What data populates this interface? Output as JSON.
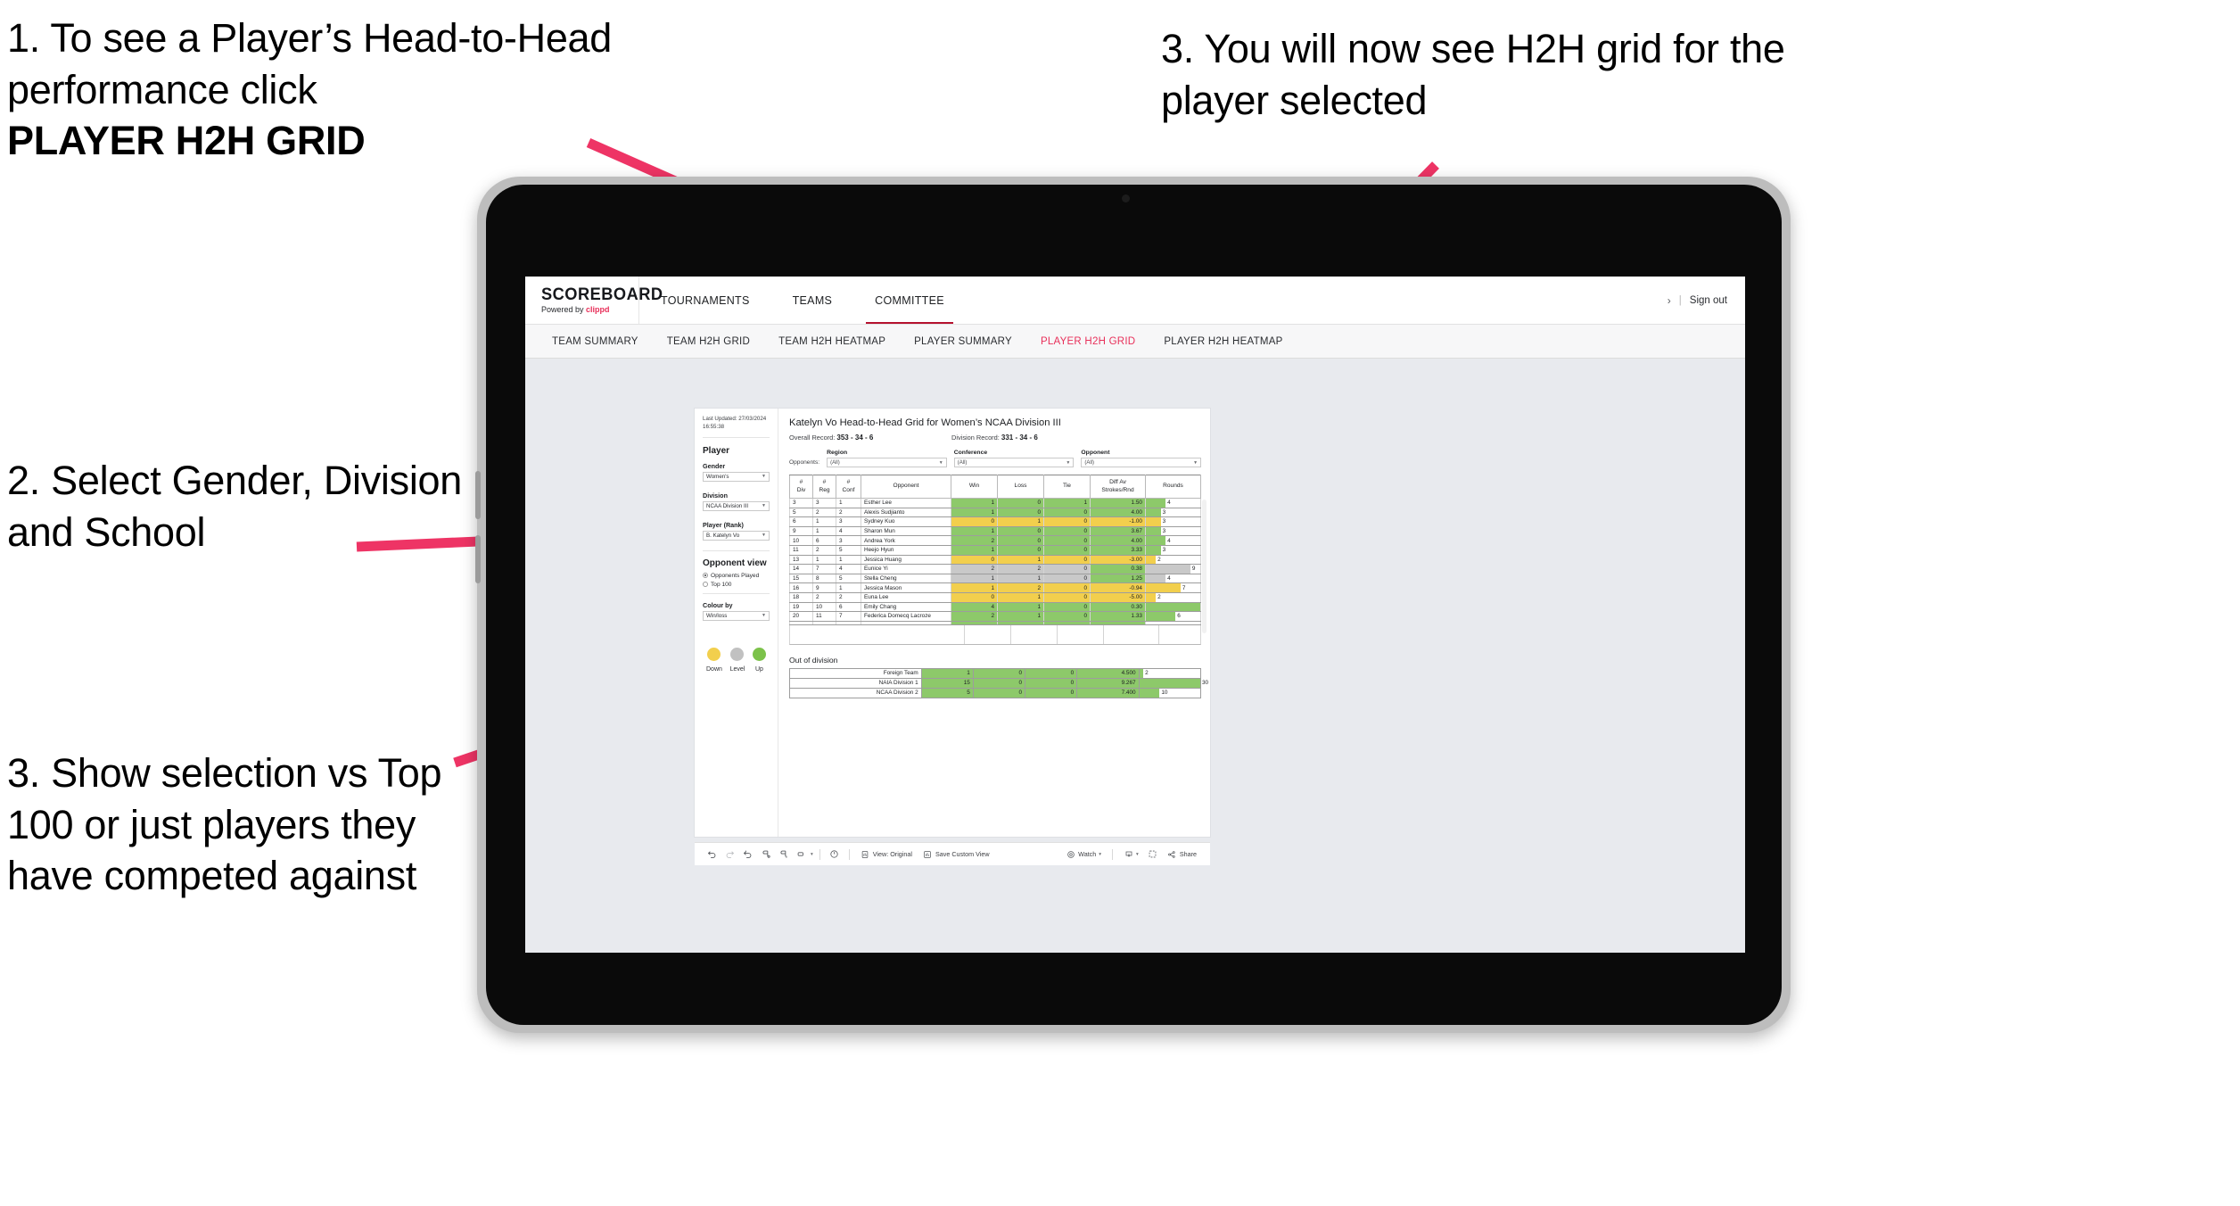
{
  "annotations": {
    "step1_line1": "1. To see a Player’s Head-to-Head performance click",
    "step1_bold": "PLAYER H2H GRID",
    "step2": "2. Select Gender, Division and School",
    "step3_left": "3. Show selection vs Top 100 or just players they have competed against",
    "step3_right": "3. You will now see H2H grid for the player selected",
    "arrow_color": "#ee3465"
  },
  "app": {
    "brand": {
      "name": "SCOREBOARD",
      "powered_prefix": "Powered by ",
      "powered_brand": "clippd"
    },
    "main_nav": [
      {
        "label": "TOURNAMENTS",
        "active": false
      },
      {
        "label": "TEAMS",
        "active": false
      },
      {
        "label": "COMMITTEE",
        "active": true
      }
    ],
    "header_right": {
      "chevron": "›",
      "separator": "|",
      "sign_out": "Sign out"
    },
    "sub_nav": [
      {
        "label": "TEAM SUMMARY",
        "active": false
      },
      {
        "label": "TEAM H2H GRID",
        "active": false
      },
      {
        "label": "TEAM H2H HEATMAP",
        "active": false
      },
      {
        "label": "PLAYER SUMMARY",
        "active": false
      },
      {
        "label": "PLAYER H2H GRID",
        "active": true
      },
      {
        "label": "PLAYER H2H HEATMAP",
        "active": false
      }
    ],
    "accent_color": "#e8305a"
  },
  "filter_panel": {
    "last_updated": "Last Updated: 27/03/2024 16:55:38",
    "section_title": "Player",
    "gender": {
      "label": "Gender",
      "value": "Women's"
    },
    "division": {
      "label": "Division",
      "value": "NCAA Division III"
    },
    "player_rank": {
      "label": "Player (Rank)",
      "value": "B. Katelyn Vo"
    },
    "opponent_view": {
      "label": "Opponent view",
      "options": [
        {
          "label": "Opponents Played",
          "selected": true
        },
        {
          "label": "Top 100",
          "selected": false
        }
      ]
    },
    "colour_by": {
      "label": "Colour by",
      "value": "Win/loss"
    },
    "legend": [
      {
        "caption": "Down",
        "color": "#f2cf4d"
      },
      {
        "caption": "Level",
        "color": "#c1c1c1"
      },
      {
        "caption": "Up",
        "color": "#7cc24a"
      }
    ]
  },
  "viz": {
    "title": "Katelyn Vo Head-to-Head Grid for Women’s NCAA Division III",
    "overall_record": {
      "label": "Overall Record:",
      "value": "353 -  34 - 6"
    },
    "division_record": {
      "label": "Division Record:",
      "value": "331 -  34 - 6"
    },
    "opponents_label": "Opponents:",
    "opponent_filters": [
      {
        "head": "Region",
        "value": "(All)"
      },
      {
        "head": "Conference",
        "value": "(All)"
      },
      {
        "head": "Opponent",
        "value": "(All)"
      }
    ]
  },
  "chart_data": {
    "type": "table",
    "title": "Katelyn Vo Head-to-Head Grid for Women’s NCAA Division III",
    "columns": [
      "# Div",
      "# Reg",
      "# Conf",
      "Opponent",
      "Win",
      "Loss",
      "Tie",
      "Diff Av Strokes/Rnd",
      "Rounds"
    ],
    "column_head_lines": [
      [
        "#",
        "Div"
      ],
      [
        "#",
        "Reg"
      ],
      [
        "#",
        "Conf"
      ],
      [
        "Opponent"
      ],
      [
        "Win"
      ],
      [
        "Loss"
      ],
      [
        "Tie"
      ],
      [
        "Diff Av",
        "Strokes/Rnd"
      ],
      [
        "Rounds"
      ]
    ],
    "rounds_max": 11,
    "rows": [
      {
        "div": "3",
        "reg": "3",
        "conf": "1",
        "opponent": "Esther Lee",
        "win": "1",
        "loss": "0",
        "tie": "1",
        "diff": "1.50",
        "rounds": 4,
        "color": "green"
      },
      {
        "div": "5",
        "reg": "2",
        "conf": "2",
        "opponent": "Alexis Sudjianto",
        "win": "1",
        "loss": "0",
        "tie": "0",
        "diff": "4.00",
        "rounds": 3,
        "color": "green"
      },
      {
        "div": "6",
        "reg": "1",
        "conf": "3",
        "opponent": "Sydney Kuo",
        "win": "0",
        "loss": "1",
        "tie": "0",
        "diff": "-1.00",
        "rounds": 3,
        "color": "yellow"
      },
      {
        "div": "9",
        "reg": "1",
        "conf": "4",
        "opponent": "Sharon Mun",
        "win": "1",
        "loss": "0",
        "tie": "0",
        "diff": "3.67",
        "rounds": 3,
        "color": "green"
      },
      {
        "div": "10",
        "reg": "6",
        "conf": "3",
        "opponent": "Andrea York",
        "win": "2",
        "loss": "0",
        "tie": "0",
        "diff": "4.00",
        "rounds": 4,
        "color": "green"
      },
      {
        "div": "11",
        "reg": "2",
        "conf": "5",
        "opponent": "Heejo Hyun",
        "win": "1",
        "loss": "0",
        "tie": "0",
        "diff": "3.33",
        "rounds": 3,
        "color": "green"
      },
      {
        "div": "13",
        "reg": "1",
        "conf": "1",
        "opponent": "Jessica Huang",
        "win": "0",
        "loss": "1",
        "tie": "0",
        "diff": "-3.00",
        "rounds": 2,
        "color": "yellow"
      },
      {
        "div": "14",
        "reg": "7",
        "conf": "4",
        "opponent": "Eunice Yi",
        "win": "2",
        "loss": "2",
        "tie": "0",
        "diff": "0.38",
        "rounds": 9,
        "color": "grey",
        "diff_color": "green"
      },
      {
        "div": "15",
        "reg": "8",
        "conf": "5",
        "opponent": "Stella Cheng",
        "win": "1",
        "loss": "1",
        "tie": "0",
        "diff": "1.25",
        "rounds": 4,
        "color": "grey",
        "diff_color": "green"
      },
      {
        "div": "16",
        "reg": "9",
        "conf": "1",
        "opponent": "Jessica Mason",
        "win": "1",
        "loss": "2",
        "tie": "0",
        "diff": "-0.94",
        "rounds": 7,
        "color": "yellow"
      },
      {
        "div": "18",
        "reg": "2",
        "conf": "2",
        "opponent": "Euna Lee",
        "win": "0",
        "loss": "1",
        "tie": "0",
        "diff": "-5.00",
        "rounds": 2,
        "color": "yellow"
      },
      {
        "div": "19",
        "reg": "10",
        "conf": "6",
        "opponent": "Emily Chang",
        "win": "4",
        "loss": "1",
        "tie": "0",
        "diff": "0.30",
        "rounds": 11,
        "color": "green"
      },
      {
        "div": "20",
        "reg": "11",
        "conf": "7",
        "opponent": "Federica Domecq Lacroze",
        "win": "2",
        "loss": "1",
        "tie": "0",
        "diff": "1.33",
        "rounds": 6,
        "color": "green"
      }
    ],
    "out_of_division": {
      "title": "Out of division",
      "rounds_max": 30,
      "rows": [
        {
          "name": "Foreign Team",
          "win": "1",
          "loss": "0",
          "tie": "0",
          "diff": "4.500",
          "rounds": 2,
          "color": "green"
        },
        {
          "name": "NAIA Division 1",
          "win": "15",
          "loss": "0",
          "tie": "0",
          "diff": "9.267",
          "rounds": 30,
          "color": "green"
        },
        {
          "name": "NCAA Division 2",
          "win": "5",
          "loss": "0",
          "tie": "0",
          "diff": "7.400",
          "rounds": 10,
          "color": "green"
        }
      ]
    }
  },
  "toolbar": {
    "view_label": "View: Original",
    "save_custom_view": "Save Custom View",
    "watch": "Watch",
    "share": "Share",
    "caret": "▾"
  }
}
